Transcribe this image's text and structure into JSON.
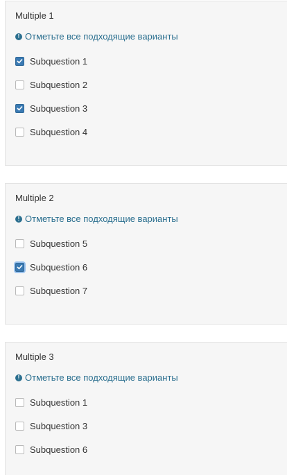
{
  "hint_text": "Отметьте все подходящие варианты",
  "accent_color": "#3a7ab3",
  "hint_color": "#2b6f8f",
  "questions": [
    {
      "title": "Multiple 1",
      "options": [
        {
          "label": "Subquestion 1",
          "checked": true
        },
        {
          "label": "Subquestion 2",
          "checked": false
        },
        {
          "label": "Subquestion 3",
          "checked": true
        },
        {
          "label": "Subquestion 4",
          "checked": false
        }
      ]
    },
    {
      "title": "Multiple 2",
      "options": [
        {
          "label": "Subquestion 5",
          "checked": false
        },
        {
          "label": "Subquestion 6",
          "checked": true,
          "focused": true
        },
        {
          "label": "Subquestion 7",
          "checked": false
        }
      ]
    },
    {
      "title": "Multiple 3",
      "options": [
        {
          "label": "Subquestion 1",
          "checked": false
        },
        {
          "label": "Subquestion 3",
          "checked": false
        },
        {
          "label": "Subquestion 6",
          "checked": false
        }
      ]
    }
  ]
}
